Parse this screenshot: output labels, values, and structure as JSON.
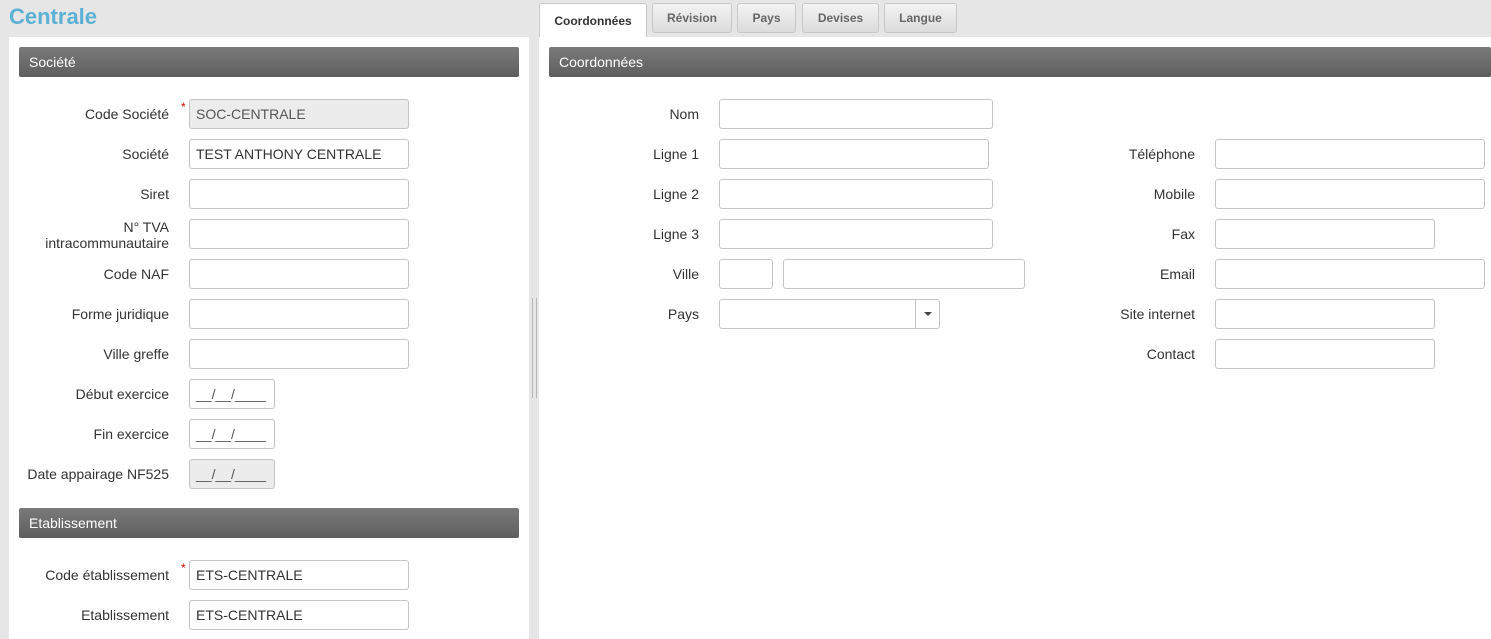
{
  "app": {
    "title": "Centrale"
  },
  "tabs": [
    {
      "label": "Coordonnées",
      "active": true
    },
    {
      "label": "Révision",
      "active": false
    },
    {
      "label": "Pays",
      "active": false
    },
    {
      "label": "Devises",
      "active": false
    },
    {
      "label": "Langue",
      "active": false
    }
  ],
  "societe": {
    "header": "Société",
    "fields": {
      "code_societe": {
        "label": "Code Société",
        "value": "SOC-CENTRALE",
        "required": true
      },
      "societe": {
        "label": "Société",
        "value": "TEST ANTHONY CENTRALE"
      },
      "siret": {
        "label": "Siret",
        "value": ""
      },
      "tva_line1": "N° TVA",
      "tva_line2": "intracommunautaire",
      "tva_value": "",
      "code_naf": {
        "label": "Code NAF",
        "value": ""
      },
      "forme_juridique": {
        "label": "Forme juridique",
        "value": ""
      },
      "ville_greffe": {
        "label": "Ville greffe",
        "value": ""
      },
      "debut_exercice": {
        "label": "Début exercice",
        "value": "__/__/____"
      },
      "fin_exercice": {
        "label": "Fin exercice",
        "value": "__/__/____"
      },
      "date_appairage": {
        "label": "Date appairage NF525",
        "value": "__/__/____"
      }
    }
  },
  "etablissement": {
    "header": "Etablissement",
    "fields": {
      "code_etablissement": {
        "label": "Code établissement",
        "value": "ETS-CENTRALE",
        "required": true
      },
      "etablissement": {
        "label": "Etablissement",
        "value": "ETS-CENTRALE"
      }
    }
  },
  "required_marker": "*",
  "coordonnees": {
    "header": "Coordonnées",
    "left": {
      "nom": {
        "label": "Nom",
        "value": ""
      },
      "ligne1": {
        "label": "Ligne 1",
        "value": ""
      },
      "ligne2": {
        "label": "Ligne 2",
        "value": ""
      },
      "ligne3": {
        "label": "Ligne 3",
        "value": ""
      },
      "ville": {
        "label": "Ville",
        "cp_value": "",
        "value": ""
      },
      "pays": {
        "label": "Pays",
        "value": ""
      }
    },
    "right": {
      "telephone": {
        "label": "Téléphone",
        "value": ""
      },
      "mobile": {
        "label": "Mobile",
        "value": ""
      },
      "fax": {
        "label": "Fax",
        "value": ""
      },
      "email": {
        "label": "Email",
        "value": ""
      },
      "site_internet": {
        "label": "Site internet",
        "value": ""
      },
      "contact": {
        "label": "Contact",
        "value": ""
      }
    }
  }
}
